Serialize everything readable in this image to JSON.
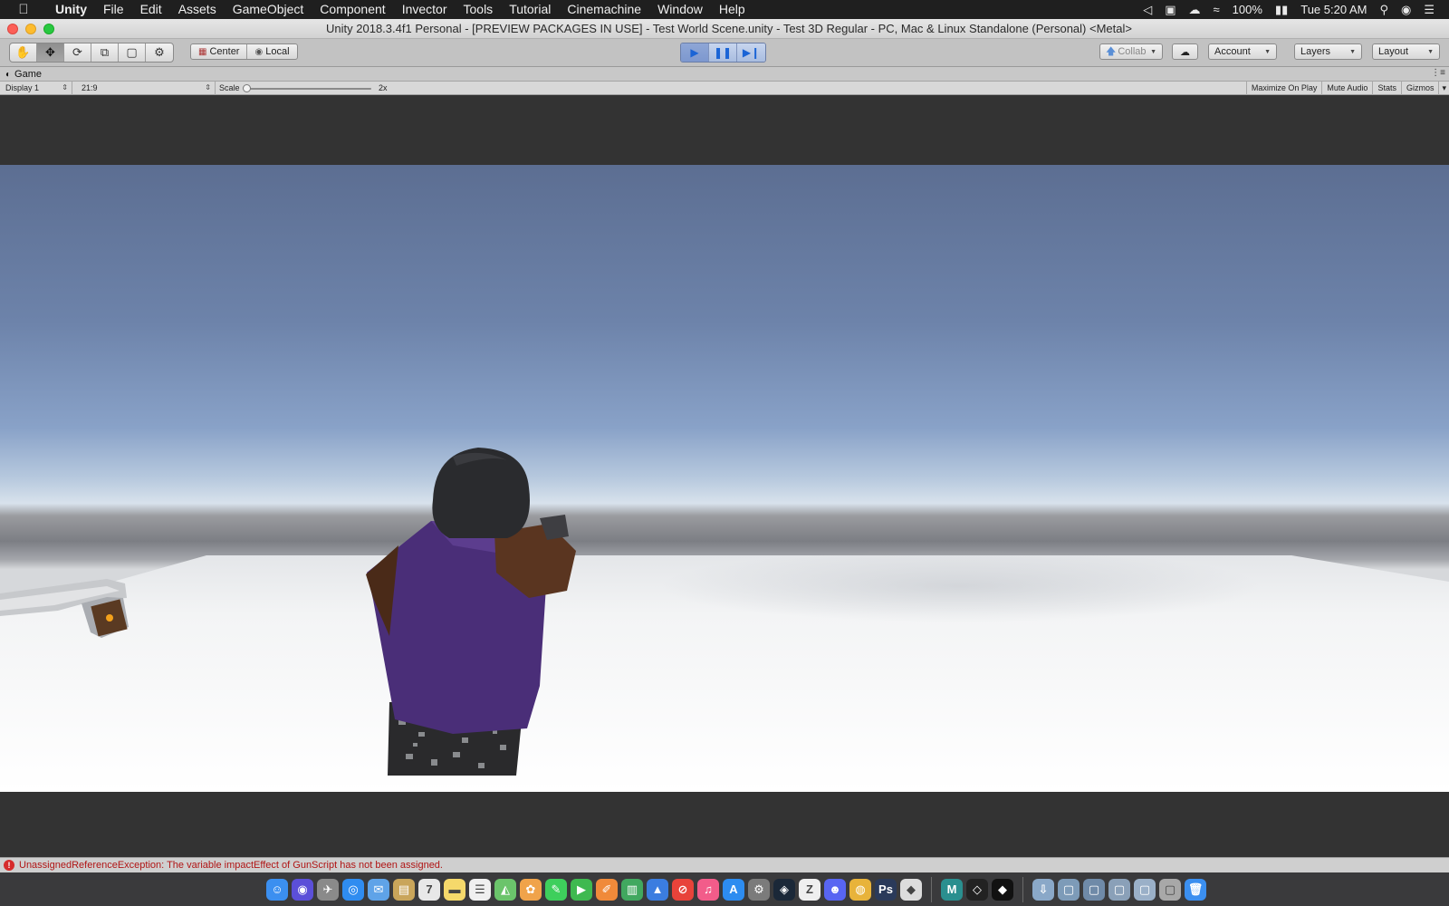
{
  "menubar": {
    "items": [
      "Unity",
      "File",
      "Edit",
      "Assets",
      "GameObject",
      "Component",
      "Invector",
      "Tools",
      "Tutorial",
      "Cinemachine",
      "Window",
      "Help"
    ],
    "battery": "100%",
    "clock": "Tue 5:20 AM"
  },
  "window": {
    "title": "Unity 2018.3.4f1 Personal - [PREVIEW PACKAGES IN USE] - Test World Scene.unity - Test 3D Regular - PC, Mac & Linux Standalone (Personal) <Metal>"
  },
  "toolbar": {
    "pivot_mode": "Center",
    "pivot_space": "Local",
    "collab_label": "Collab",
    "account_label": "Account",
    "layers_label": "Layers",
    "layout_label": "Layout"
  },
  "game_panel": {
    "tab_label": "Game",
    "display": "Display 1",
    "aspect": "21:9",
    "scale_label": "Scale",
    "scale_value": "2x",
    "maximize_on_play": "Maximize On Play",
    "mute_audio": "Mute Audio",
    "stats": "Stats",
    "gizmos": "Gizmos"
  },
  "console": {
    "error_message": "UnassignedReferenceException: The variable impactEffect of GunScript has not been assigned."
  },
  "colors": {
    "play_active": "#1a64d6",
    "error_text": "#b01515",
    "shirt": "#4a2e78"
  },
  "dock": {
    "apps": [
      "finder-icon",
      "siri-icon",
      "launchpad-icon",
      "safari-icon",
      "mail-icon",
      "notes-icon",
      "calendar-icon",
      "stickies-icon",
      "reminders-icon",
      "maps-icon",
      "photos-icon",
      "messages-icon",
      "facetime-icon",
      "pages-icon",
      "numbers-icon",
      "keynote-icon",
      "news-icon",
      "music-icon",
      "app-store-icon",
      "system-preferences-icon",
      "steam-icon",
      "zbrush-icon",
      "discord-icon",
      "chrome-icon",
      "photoshop-icon",
      "roblox-icon",
      "maya-icon",
      "unity-hub-icon",
      "unity-icon",
      "downloads-icon",
      "folder-icon",
      "folder-icon-2",
      "folder-icon-3",
      "folder-icon-4",
      "folder-icon-5",
      "trash-icon"
    ]
  }
}
